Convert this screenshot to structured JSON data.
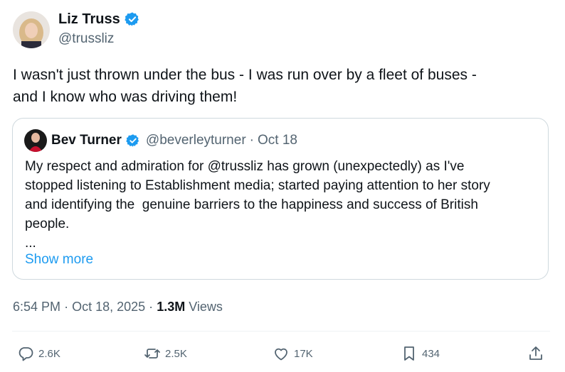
{
  "author": {
    "name": "Liz Truss",
    "handle": "@trussliz"
  },
  "tweet": {
    "lines": [
      "I wasn't just thrown under the bus - I was run over by a fleet of buses -",
      "and I know who was driving them!"
    ]
  },
  "quoted": {
    "name": "Bev Turner",
    "handle": "@beverleyturner",
    "separator": "·",
    "date": "Oct 18",
    "lines": [
      "My respect and admiration for @trussliz has grown (unexpectedly) as I've",
      "stopped listening to Establishment media; started paying attention to her story",
      "and identifying the  genuine barriers to the happiness and success of British",
      "people.",
      "..."
    ],
    "show_more": "Show more"
  },
  "meta": {
    "time": "6:54 PM",
    "sep1": "·",
    "date": "Oct 18, 2025",
    "sep2": "·",
    "views_count": "1.3M",
    "views_label": "Views"
  },
  "actions": {
    "replies": "2.6K",
    "reposts": "2.5K",
    "likes": "17K",
    "bookmarks": "434"
  },
  "colors": {
    "accent": "#1d9bf0",
    "text": "#0f1419",
    "secondary": "#536471",
    "border": "#cfd9de"
  },
  "icons": {
    "verified": "verified-badge-icon",
    "reply": "reply-icon",
    "repost": "repost-icon",
    "like": "heart-icon",
    "bookmark": "bookmark-icon",
    "share": "share-icon"
  }
}
